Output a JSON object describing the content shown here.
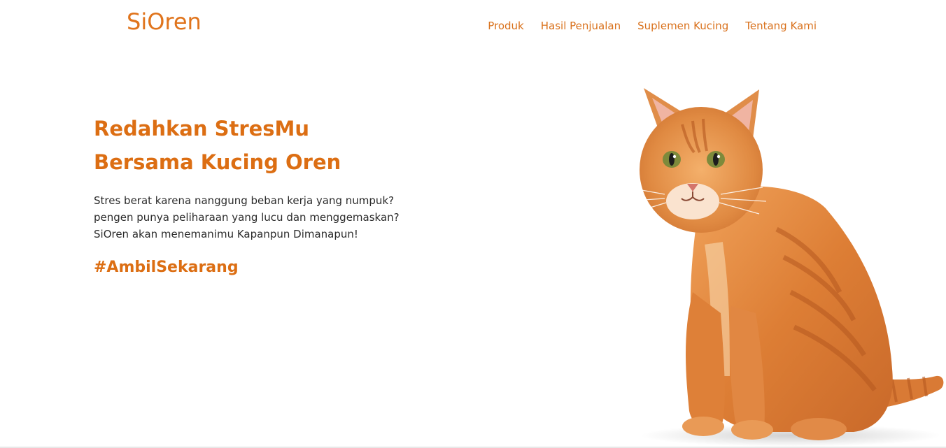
{
  "brand": {
    "logo_text": "SiOren"
  },
  "nav": {
    "items": [
      {
        "label": "Produk"
      },
      {
        "label": "Hasil Penjualan"
      },
      {
        "label": "Suplemen Kucing"
      },
      {
        "label": "Tentang Kami"
      }
    ]
  },
  "hero": {
    "title_line1": "Redahkan StresMu",
    "title_line2": "Bersama Kucing Oren",
    "desc_line1": "Stres berat karena nanggung beban kerja yang numpuk?",
    "desc_line2": "pengen punya peliharaan yang lucu dan menggemaskan?",
    "desc_line3": "SiOren akan menemanimu Kapanpun Dimanapun!",
    "hashtag": "#AmbilSekarang"
  },
  "colors": {
    "accent": "#dc6e13",
    "text": "#2b2b2b",
    "background": "#ffffff"
  },
  "image": {
    "subject": "orange-tabby-cat"
  }
}
